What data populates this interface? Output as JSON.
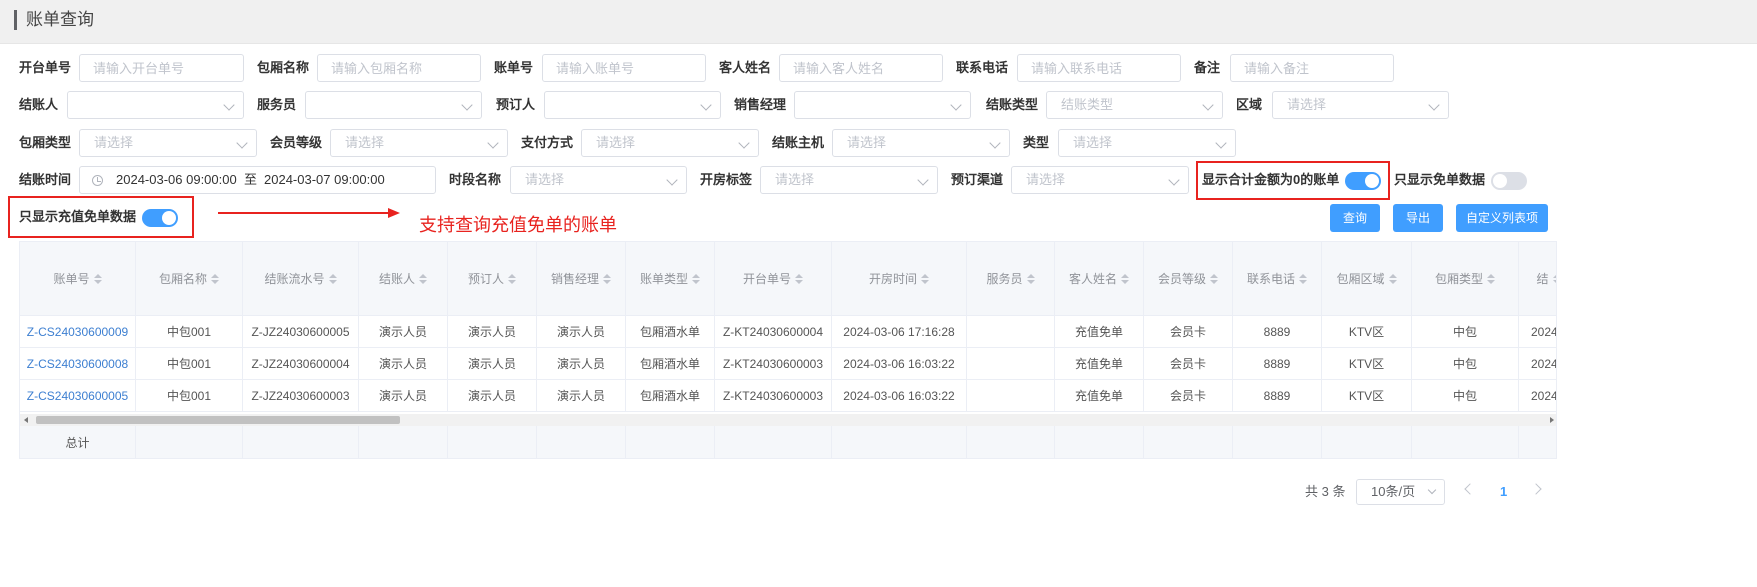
{
  "header": {
    "title": "账单查询"
  },
  "filters": {
    "open_no": {
      "label": "开台单号",
      "placeholder": "请输入开台单号"
    },
    "room_name": {
      "label": "包厢名称",
      "placeholder": "请输入包厢名称"
    },
    "bill_no": {
      "label": "账单号",
      "placeholder": "请输入账单号"
    },
    "guest_name": {
      "label": "客人姓名",
      "placeholder": "请输入客人姓名"
    },
    "phone": {
      "label": "联系电话",
      "placeholder": "请输入联系电话"
    },
    "remark": {
      "label": "备注",
      "placeholder": "请输入备注"
    },
    "cashier": {
      "label": "结账人",
      "value": ""
    },
    "waiter": {
      "label": "服务员",
      "value": ""
    },
    "booker": {
      "label": "预订人",
      "value": ""
    },
    "sales_manager": {
      "label": "销售经理",
      "value": ""
    },
    "settle_type": {
      "label": "结账类型",
      "placeholder": "结账类型"
    },
    "area": {
      "label": "区域",
      "placeholder": "请选择"
    },
    "room_type": {
      "label": "包厢类型",
      "placeholder": "请选择"
    },
    "member_level": {
      "label": "会员等级",
      "placeholder": "请选择"
    },
    "pay_method": {
      "label": "支付方式",
      "placeholder": "请选择"
    },
    "settle_host": {
      "label": "结账主机",
      "placeholder": "请选择"
    },
    "type": {
      "label": "类型",
      "placeholder": "请选择"
    },
    "settle_time": {
      "label": "结账时间",
      "start": "2024-03-06 09:00:00",
      "separator": "至",
      "end": "2024-03-07 09:00:00"
    },
    "period_name": {
      "label": "时段名称",
      "placeholder": "请选择"
    },
    "open_tag": {
      "label": "开房标签",
      "placeholder": "请选择"
    },
    "booking_channel": {
      "label": "预订渠道",
      "placeholder": "请选择"
    }
  },
  "toggles": {
    "show_zero_total": {
      "label": "显示合计金额为0的账单",
      "on": true
    },
    "only_free": {
      "label": "只显示免单数据",
      "on": false
    },
    "only_recharge_free": {
      "label": "只显示充值免单数据",
      "on": true
    }
  },
  "annotation": {
    "text": "支持查询充值免单的账单",
    "color": "#e8231f"
  },
  "buttons": {
    "query": "查询",
    "export": "导出",
    "custom_columns": "自定义列表项"
  },
  "table": {
    "columns": [
      "账单号",
      "包厢名称",
      "结账流水号",
      "结账人",
      "预订人",
      "销售经理",
      "账单类型",
      "开台单号",
      "开房时间",
      "服务员",
      "客人姓名",
      "会员等级",
      "联系电话",
      "包厢区域",
      "包厢类型",
      "结"
    ],
    "rows": [
      [
        "Z-CS24030600009",
        "中包001",
        "Z-JZ24030600005",
        "演示人员",
        "演示人员",
        "演示人员",
        "包厢酒水单",
        "Z-KT24030600004",
        "2024-03-06 17:16:28",
        "",
        "充值免单",
        "会员卡",
        "8889",
        "KTV区",
        "中包",
        "2024"
      ],
      [
        "Z-CS24030600008",
        "中包001",
        "Z-JZ24030600004",
        "演示人员",
        "演示人员",
        "演示人员",
        "包厢酒水单",
        "Z-KT24030600003",
        "2024-03-06 16:03:22",
        "",
        "充值免单",
        "会员卡",
        "8889",
        "KTV区",
        "中包",
        "2024"
      ],
      [
        "Z-CS24030600005",
        "中包001",
        "Z-JZ24030600003",
        "演示人员",
        "演示人员",
        "演示人员",
        "包厢酒水单",
        "Z-KT24030600003",
        "2024-03-06 16:03:22",
        "",
        "充值免单",
        "会员卡",
        "8889",
        "KTV区",
        "中包",
        "2024"
      ]
    ],
    "total_label": "总计"
  },
  "pagination": {
    "total_text": "共 3 条",
    "page_size": "10条/页",
    "current_page": "1"
  },
  "colors": {
    "primary": "#409eff",
    "link": "#3d7fd1",
    "highlight": "#e8231f"
  }
}
